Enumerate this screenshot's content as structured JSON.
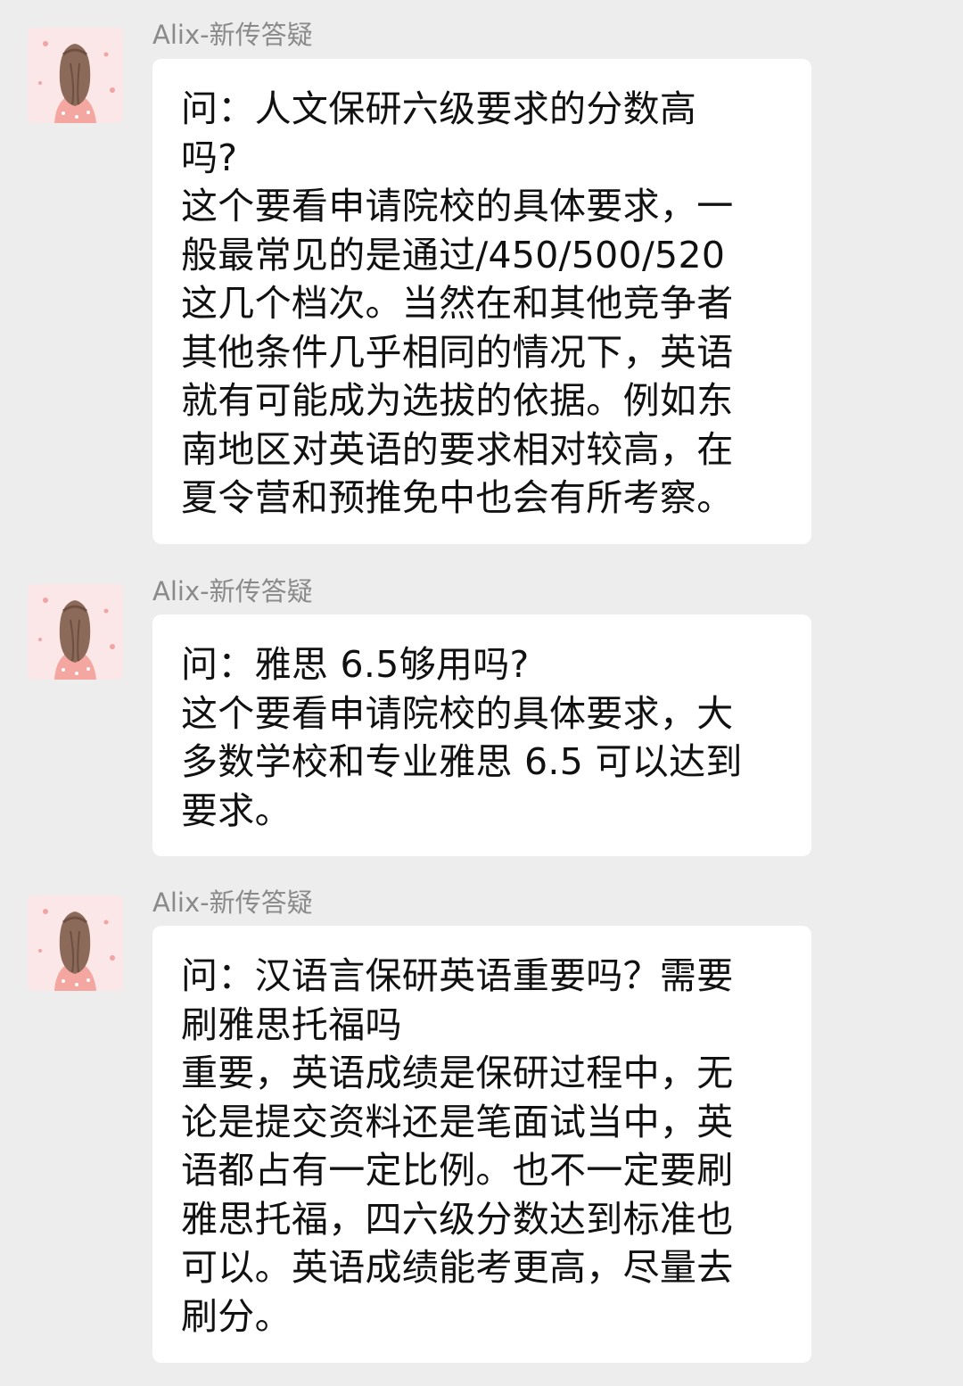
{
  "messages": [
    {
      "sender": "Alix-新传答疑",
      "avatar_icon": "girl-with-braid-avatar-icon",
      "lines": [
        "问：人文保研六级要求的分数高",
        "吗?",
        "这个要看申请院校的具体要求，一",
        "般最常见的是通过/450/500/520",
        "这几个档次。当然在和其他竞争者",
        "其他条件几乎相同的情况下，英语",
        "就有可能成为选拔的依据。例如东",
        "南地区对英语的要求相对较高，在",
        "夏令营和预推免中也会有所考察。"
      ]
    },
    {
      "sender": "Alix-新传答疑",
      "avatar_icon": "girl-with-braid-avatar-icon",
      "lines": [
        "问：雅思 6.5够用吗?",
        "这个要看申请院校的具体要求，大",
        "多数学校和专业雅思 6.5 可以达到",
        "要求。"
      ]
    },
    {
      "sender": "Alix-新传答疑",
      "avatar_icon": "girl-with-braid-avatar-icon",
      "lines": [
        "问：汉语言保研英语重要吗？需要",
        "刷雅思托福吗",
        "重要，英语成绩是保研过程中，无",
        "论是提交资料还是笔面试当中，英",
        "语都占有一定比例。也不一定要刷",
        "雅思托福，四六级分数达到标准也",
        "可以。英语成绩能考更高，尽量去",
        "刷分。"
      ]
    }
  ],
  "colors": {
    "background": "#ededed",
    "bubble": "#ffffff",
    "sender": "#8a8a8a",
    "text": "#111111"
  }
}
